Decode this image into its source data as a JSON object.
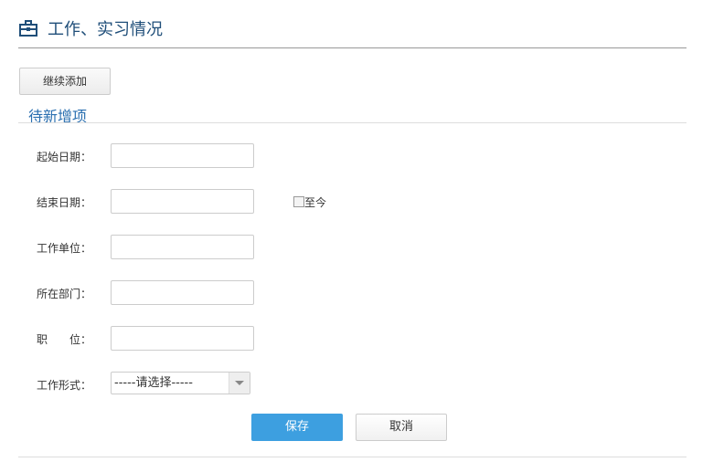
{
  "header": {
    "title": "工作、实习情况",
    "icon": "briefcase-icon"
  },
  "add_button": "继续添加",
  "section_title": "待新增项",
  "fields": [
    {
      "label": "起始日期：",
      "value": ""
    },
    {
      "label": "结束日期：",
      "value": ""
    },
    {
      "label": "工作单位：",
      "value": ""
    },
    {
      "label": "所在部门：",
      "value": ""
    },
    {
      "label": "职　　位：",
      "value": ""
    },
    {
      "label": "工作形式：",
      "value": "-----请选择-----"
    }
  ],
  "until_now_label": "至今",
  "save_label": "保存",
  "cancel_label": "取消"
}
